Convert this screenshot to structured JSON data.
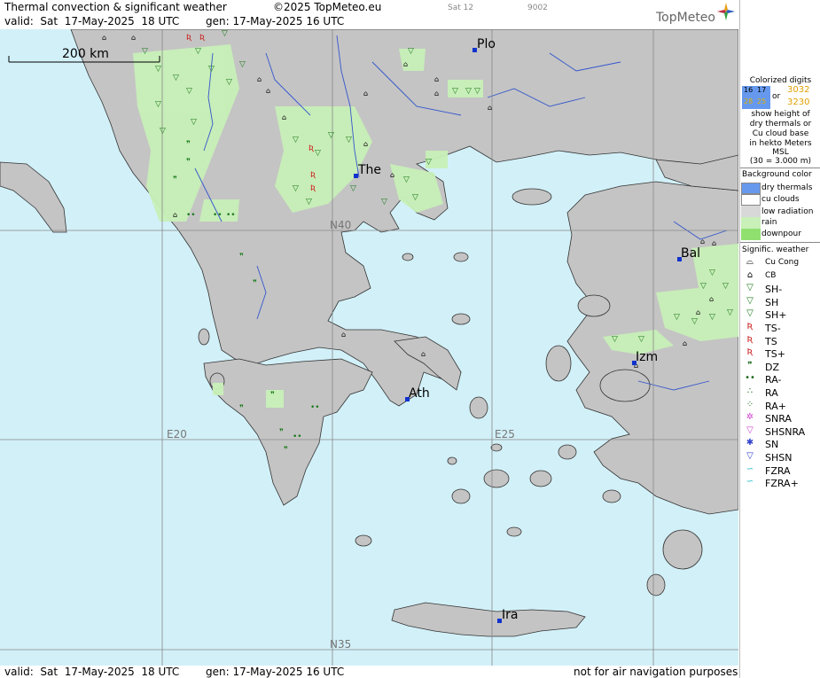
{
  "header": {
    "title": "Thermal convection & significant weather",
    "copyright": "©2025 TopMeteo.eu",
    "day_code": "Sat 12",
    "code": "9002",
    "valid": "valid:  Sat  17-May-2025  18 UTC",
    "generated": "gen: 17-May-2025 16 UTC",
    "logo": "TopMeteo"
  },
  "map": {
    "scale_label": "200 km",
    "cities": [
      {
        "label": "Plo"
      },
      {
        "label": "The"
      },
      {
        "label": "Bal"
      },
      {
        "label": "Izm"
      },
      {
        "label": "Ath"
      },
      {
        "label": "Ira"
      }
    ],
    "grid_labels": [
      "N40",
      "E20",
      "E25",
      "N35"
    ]
  },
  "legend": {
    "colorized": [
      "Colorized digits"
    ],
    "digit_samples": [
      "16",
      "17",
      "28",
      "25",
      "or",
      "3032",
      "3230"
    ],
    "description": [
      "show height of",
      "dry thermals or",
      "Cu cloud base",
      "in hekto Meters",
      "MSL",
      "(30 = 3.000 m)"
    ],
    "background_title": "Background color",
    "backgrounds": [
      {
        "label": "dry thermals",
        "color": "#6699ee"
      },
      {
        "label": "cu clouds",
        "color": "#ffffff"
      },
      {
        "label": "low radiation",
        "color": "#d8d8d8"
      },
      {
        "label": "rain",
        "color": "#c8f0b8"
      },
      {
        "label": "downpour",
        "color": "#90e070"
      }
    ],
    "weather_title": "Signific. weather",
    "weather": [
      {
        "label": "Cu Cong",
        "icon": "cu-cong-icon",
        "symbol": "⌓",
        "color": "#000"
      },
      {
        "label": "CB",
        "icon": "cb-icon",
        "symbol": "⌂",
        "color": "#000"
      },
      {
        "label": "SH-",
        "icon": "shower-light-icon",
        "symbol": "▽",
        "color": "#1a7a1a"
      },
      {
        "label": "SH",
        "icon": "shower-icon",
        "symbol": "▽",
        "color": "#1a7a1a"
      },
      {
        "label": "SH+",
        "icon": "shower-heavy-icon",
        "symbol": "▽",
        "color": "#1a7a1a"
      },
      {
        "label": "TS-",
        "icon": "thunderstorm-light-icon",
        "symbol": "Ʀ",
        "color": "#cc2222"
      },
      {
        "label": "TS",
        "icon": "thunderstorm-icon",
        "symbol": "Ʀ",
        "color": "#cc2222"
      },
      {
        "label": "TS+",
        "icon": "thunderstorm-heavy-icon",
        "symbol": "Ʀ",
        "color": "#cc2222"
      },
      {
        "label": "DZ",
        "icon": "drizzle-icon",
        "symbol": "❞",
        "color": "#1a6a1a"
      },
      {
        "label": "RA-",
        "icon": "rain-light-icon",
        "symbol": "••",
        "color": "#1a6a1a"
      },
      {
        "label": "RA",
        "icon": "rain-icon",
        "symbol": "∴",
        "color": "#1a6a1a"
      },
      {
        "label": "RA+",
        "icon": "rain-heavy-icon",
        "symbol": "⁘",
        "color": "#1a6a1a"
      },
      {
        "label": "SNRA",
        "icon": "snow-rain-icon",
        "symbol": "✲",
        "color": "#cc44cc"
      },
      {
        "label": "SHSNRA",
        "icon": "snow-rain-shower-icon",
        "symbol": "▽",
        "color": "#cc44cc"
      },
      {
        "label": "SN",
        "icon": "snow-icon",
        "symbol": "✱",
        "color": "#3344cc"
      },
      {
        "label": "SHSN",
        "icon": "snow-shower-icon",
        "symbol": "▽",
        "color": "#3344cc"
      },
      {
        "label": "FZRA",
        "icon": "freezing-rain-icon",
        "symbol": "∽",
        "color": "#22bbcc"
      },
      {
        "label": "FZRA+",
        "icon": "freezing-rain-heavy-icon",
        "symbol": "∽",
        "color": "#22bbcc"
      }
    ]
  },
  "footer": {
    "valid": "valid:  Sat  17-May-2025  18 UTC",
    "generated": "gen: 17-May-2025 16 UTC",
    "disclaimer": "not for air navigation purposes"
  }
}
